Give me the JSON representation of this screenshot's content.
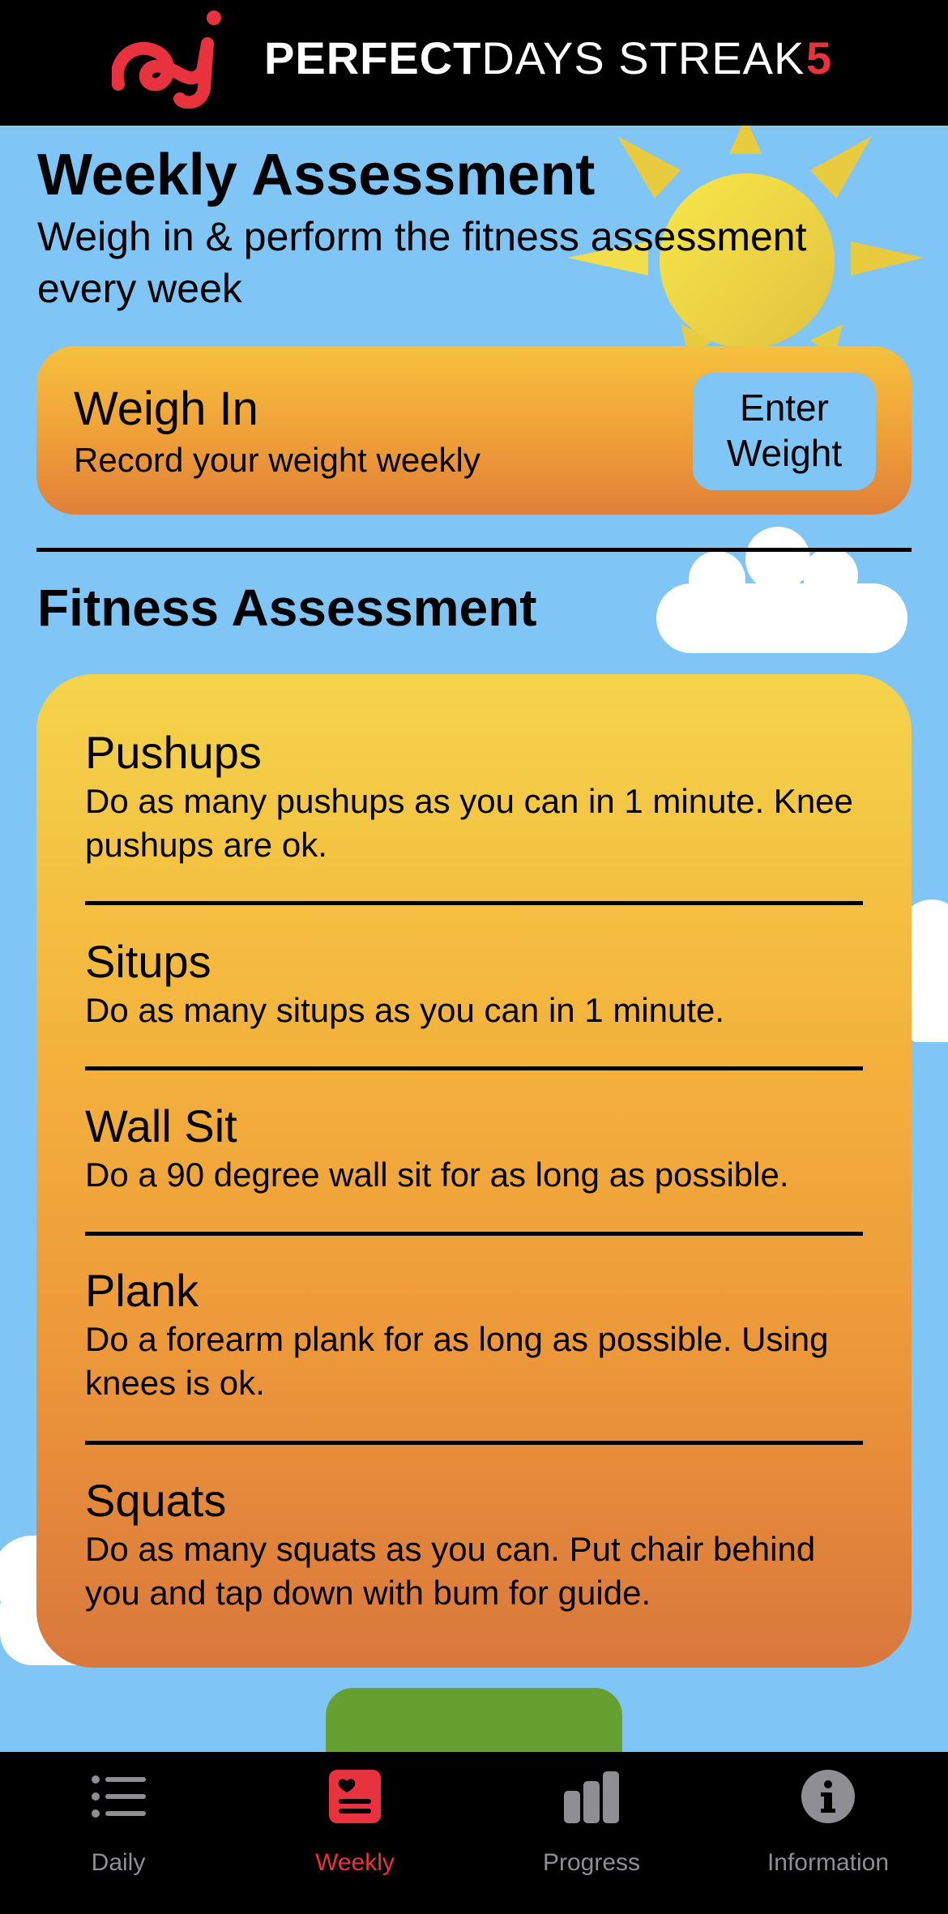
{
  "header": {
    "brand_bold": "PERFECT",
    "brand_rest": "DAYS",
    "streak_label": "STREAK",
    "streak_count": "5",
    "accent_color": "#e8333f"
  },
  "weekly": {
    "title": "Weekly Assessment",
    "subtitle": "Weigh in & perform the fitness assessment every week"
  },
  "weigh_in": {
    "title": "Weigh In",
    "subtitle": "Record your weight weekly",
    "button_label": "Enter Weight"
  },
  "fitness": {
    "title": "Fitness Assessment",
    "exercises": [
      {
        "name": "Pushups",
        "description": "Do as many pushups as you can in 1 minute. Knee pushups are ok."
      },
      {
        "name": "Situps",
        "description": "Do as many situps as you can in 1 minute."
      },
      {
        "name": "Wall Sit",
        "description": "Do a 90 degree wall sit for as long as possible."
      },
      {
        "name": "Plank",
        "description": "Do a forearm plank for as long as possible. Using knees is ok."
      },
      {
        "name": "Squats",
        "description": "Do as many squats as you can. Put chair behind you and tap down with bum for guide."
      }
    ]
  },
  "tabbar": {
    "tabs": [
      {
        "label": "Daily",
        "icon": "list-icon",
        "active": false
      },
      {
        "label": "Weekly",
        "icon": "heart-calendar-icon",
        "active": true
      },
      {
        "label": "Progress",
        "icon": "bar-chart-icon",
        "active": false
      },
      {
        "label": "Information",
        "icon": "info-icon",
        "active": false
      }
    ]
  }
}
